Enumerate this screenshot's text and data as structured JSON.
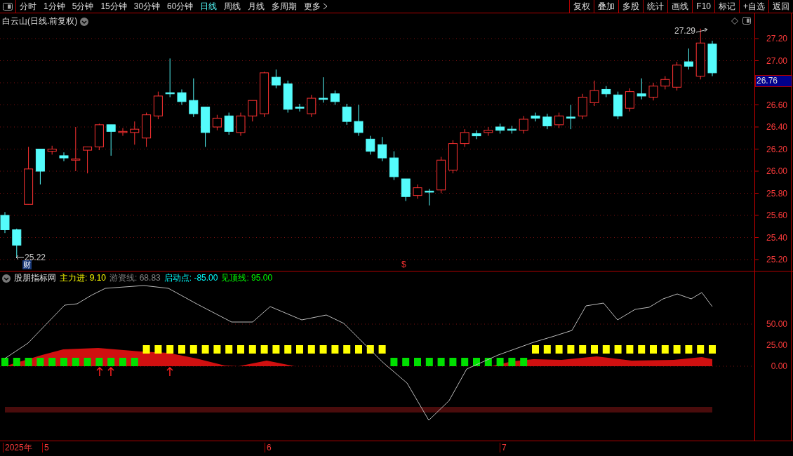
{
  "toolbar": {
    "tabs": [
      {
        "label": "分时",
        "selected": false
      },
      {
        "label": "1分钟",
        "selected": false
      },
      {
        "label": "5分钟",
        "selected": false
      },
      {
        "label": "15分钟",
        "selected": false
      },
      {
        "label": "30分钟",
        "selected": false
      },
      {
        "label": "60分钟",
        "selected": false
      },
      {
        "label": "日线",
        "selected": true
      },
      {
        "label": "周线",
        "selected": false
      },
      {
        "label": "月线",
        "selected": false
      },
      {
        "label": "多周期",
        "selected": false
      },
      {
        "label": "更多",
        "selected": false
      }
    ],
    "buttons": [
      "复权",
      "叠加",
      "多股",
      "统计",
      "画线",
      "F10",
      "标记",
      "+自选",
      "返回"
    ]
  },
  "chart": {
    "title": "白云山(日线.前复权)",
    "price_ticks": [
      "27.20",
      "27.00",
      "26.60",
      "26.40",
      "26.20",
      "26.00",
      "25.80",
      "25.60",
      "25.40",
      "25.20"
    ],
    "current_price": "26.76",
    "high_label": "27.29",
    "low_label": "25.22",
    "badge": "财",
    "marker": "$"
  },
  "indicator": {
    "name": "股朋指标网",
    "legend": [
      {
        "label": "主力进: 9.10",
        "color": "#ffff00"
      },
      {
        "label": "游资线: 68.83",
        "color": "#808080"
      },
      {
        "label": "启动点: -85.00",
        "color": "#00ffff"
      },
      {
        "label": "见顶线: 95.00",
        "color": "#00ff00"
      }
    ],
    "ticks": [
      "50.00",
      "25.00",
      "0.00"
    ]
  },
  "time_axis": [
    "2025年",
    "5",
    "6",
    "7"
  ]
}
